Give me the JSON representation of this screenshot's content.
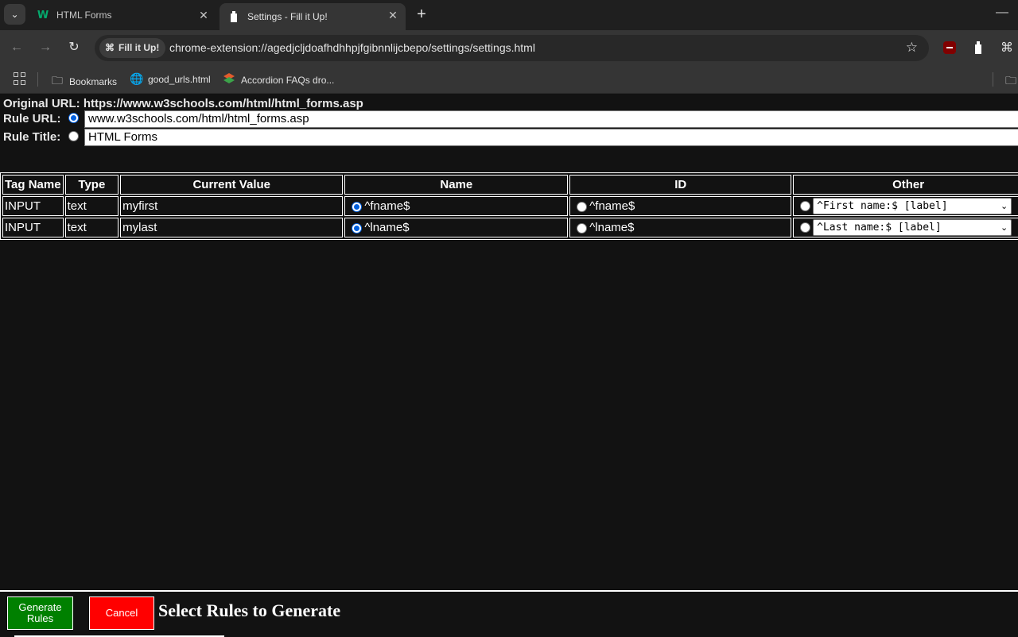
{
  "browser": {
    "tabs": [
      {
        "title": "HTML Forms",
        "icon": "w3schools-icon"
      },
      {
        "title": "Settings - Fill it Up!",
        "icon": "fill-it-up-icon"
      }
    ],
    "omnibox": {
      "chip": "Fill it Up!",
      "url": "chrome-extension://agedjcljdoafhdhhpjfgibnnlijcbepo/settings/settings.html"
    },
    "bookmarks": [
      {
        "label": "Bookmarks",
        "icon": "folder-icon"
      },
      {
        "label": "good_urls.html",
        "icon": "globe-icon"
      },
      {
        "label": "Accordion FAQs dro...",
        "icon": "layers-icon"
      }
    ]
  },
  "page": {
    "original_url_label": "Original URL:",
    "original_url": "https://www.w3schools.com/html/html_forms.asp",
    "rule_url_label": "Rule URL:",
    "rule_url_value": "www.w3schools.com/html/html_forms.asp",
    "rule_title_label": "Rule Title:",
    "rule_title_value": "HTML Forms",
    "rule_url_selected": true
  },
  "table": {
    "headers": [
      "Tag Name",
      "Type",
      "Current Value",
      "Name",
      "ID",
      "Other"
    ],
    "rows": [
      {
        "tag": "INPUT",
        "type": "text",
        "value": "myfirst",
        "name": "^fname$",
        "id": "^fname$",
        "other": "^First name:$ [label]",
        "selected": "name"
      },
      {
        "tag": "INPUT",
        "type": "text",
        "value": "mylast",
        "name": "^lname$",
        "id": "^lname$",
        "other": "^Last name:$ [label]",
        "selected": "name"
      }
    ]
  },
  "footer": {
    "generate_label_1": "Generate",
    "generate_label_2": "Rules",
    "cancel_label": "Cancel",
    "status": "Select Rules to Generate"
  },
  "colors": {
    "generate": "#008000",
    "cancel": "#ff0000",
    "radio_selected": "#0060df"
  }
}
